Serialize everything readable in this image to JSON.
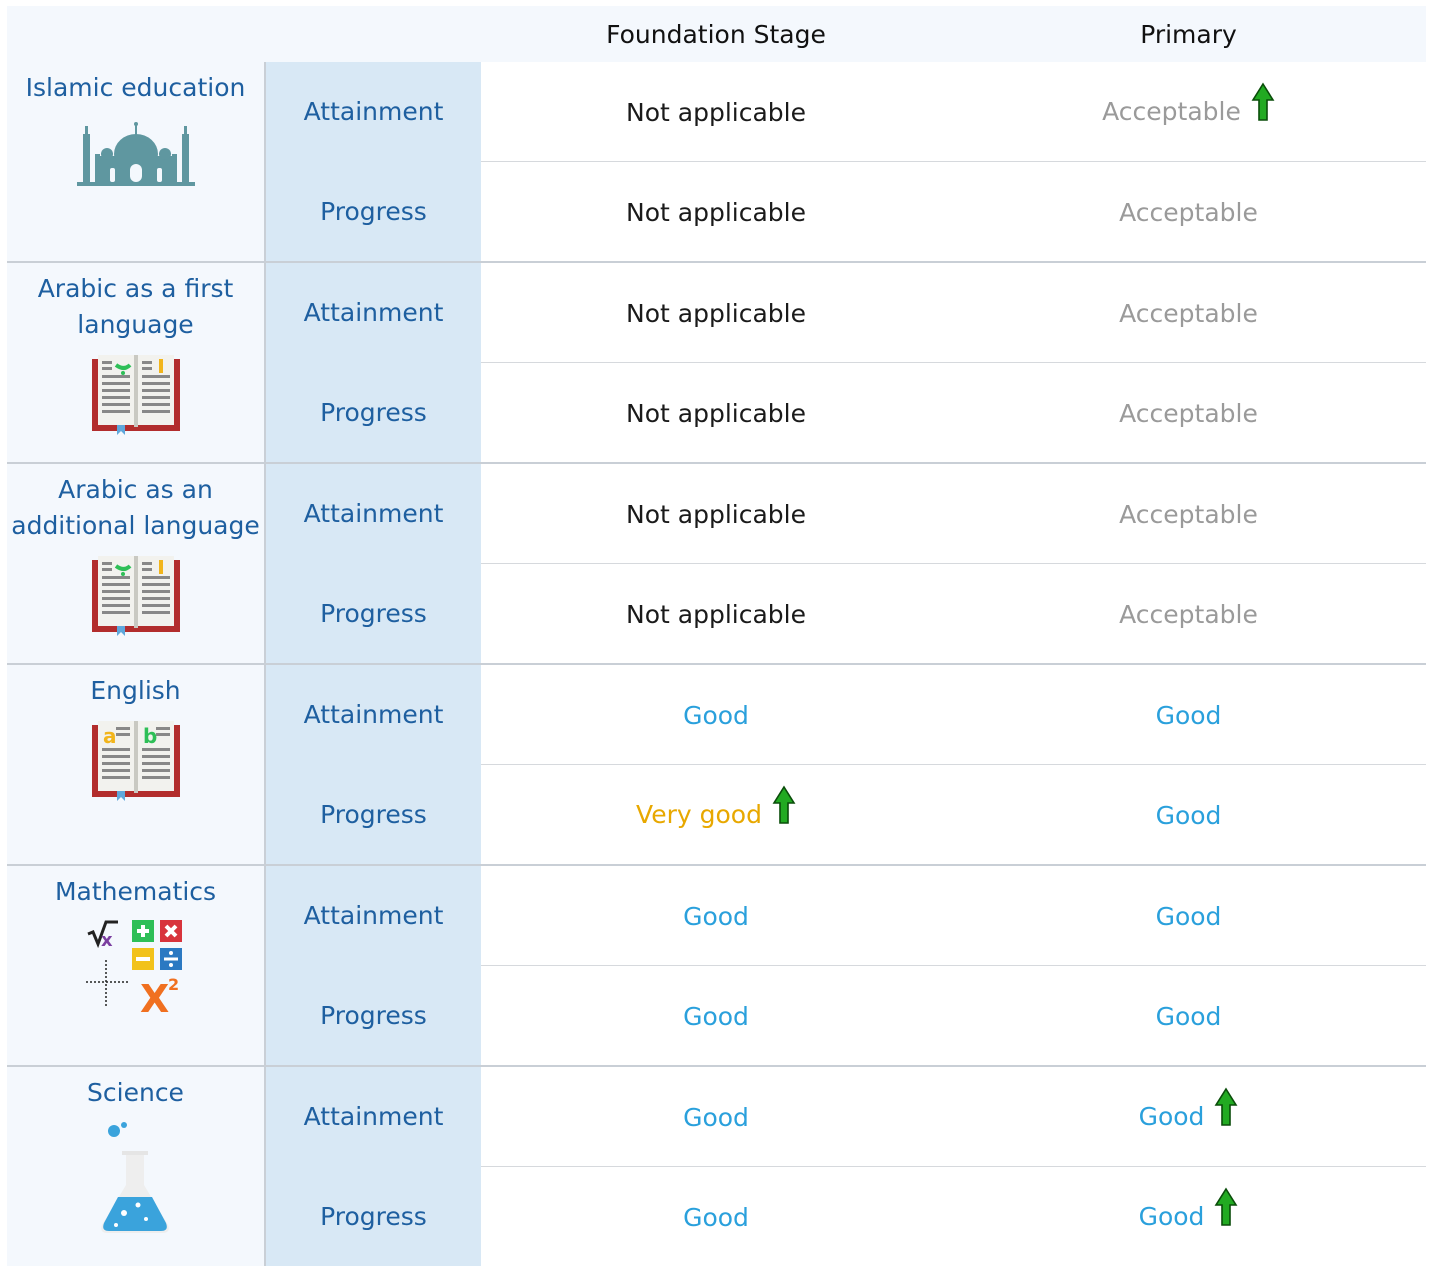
{
  "header": {
    "col_foundation": "Foundation Stage",
    "col_primary": "Primary"
  },
  "colors": {
    "blue_text": "#1e5fa0",
    "good": "#2aa0dc",
    "very_good": "#e8a800",
    "acceptable": "#9a9a9a",
    "na": "#1a1a1a",
    "arrow_up": "#22aa22"
  },
  "subjects": [
    {
      "name": "Islamic education",
      "icon": "mosque-icon",
      "rows": [
        {
          "metric": "Attainment",
          "foundation": "Not applicable",
          "primary": "Acceptable",
          "primary_arrow": "up-arrow"
        },
        {
          "metric": "Progress",
          "foundation": "Not applicable",
          "primary": "Acceptable"
        }
      ]
    },
    {
      "name": "Arabic as a first language",
      "icon": "arabic-book-icon",
      "rows": [
        {
          "metric": "Attainment",
          "foundation": "Not applicable",
          "primary": "Acceptable"
        },
        {
          "metric": "Progress",
          "foundation": "Not applicable",
          "primary": "Acceptable"
        }
      ]
    },
    {
      "name": "Arabic as an additional language",
      "icon": "arabic-book-icon",
      "rows": [
        {
          "metric": "Attainment",
          "foundation": "Not applicable",
          "primary": "Acceptable"
        },
        {
          "metric": "Progress",
          "foundation": "Not applicable",
          "primary": "Acceptable"
        }
      ]
    },
    {
      "name": "English",
      "icon": "english-book-icon",
      "rows": [
        {
          "metric": "Attainment",
          "foundation": "Good",
          "primary": "Good"
        },
        {
          "metric": "Progress",
          "foundation": "Very good",
          "foundation_arrow": "up-arrow",
          "primary": "Good"
        }
      ]
    },
    {
      "name": "Mathematics",
      "icon": "math-symbols-icon",
      "rows": [
        {
          "metric": "Attainment",
          "foundation": "Good",
          "primary": "Good"
        },
        {
          "metric": "Progress",
          "foundation": "Good",
          "primary": "Good"
        }
      ]
    },
    {
      "name": "Science",
      "icon": "flask-icon",
      "rows": [
        {
          "metric": "Attainment",
          "foundation": "Good",
          "primary": "Good",
          "primary_arrow": "up-arrow"
        },
        {
          "metric": "Progress",
          "foundation": "Good",
          "primary": "Good",
          "primary_arrow": "up-arrow"
        }
      ]
    }
  ]
}
